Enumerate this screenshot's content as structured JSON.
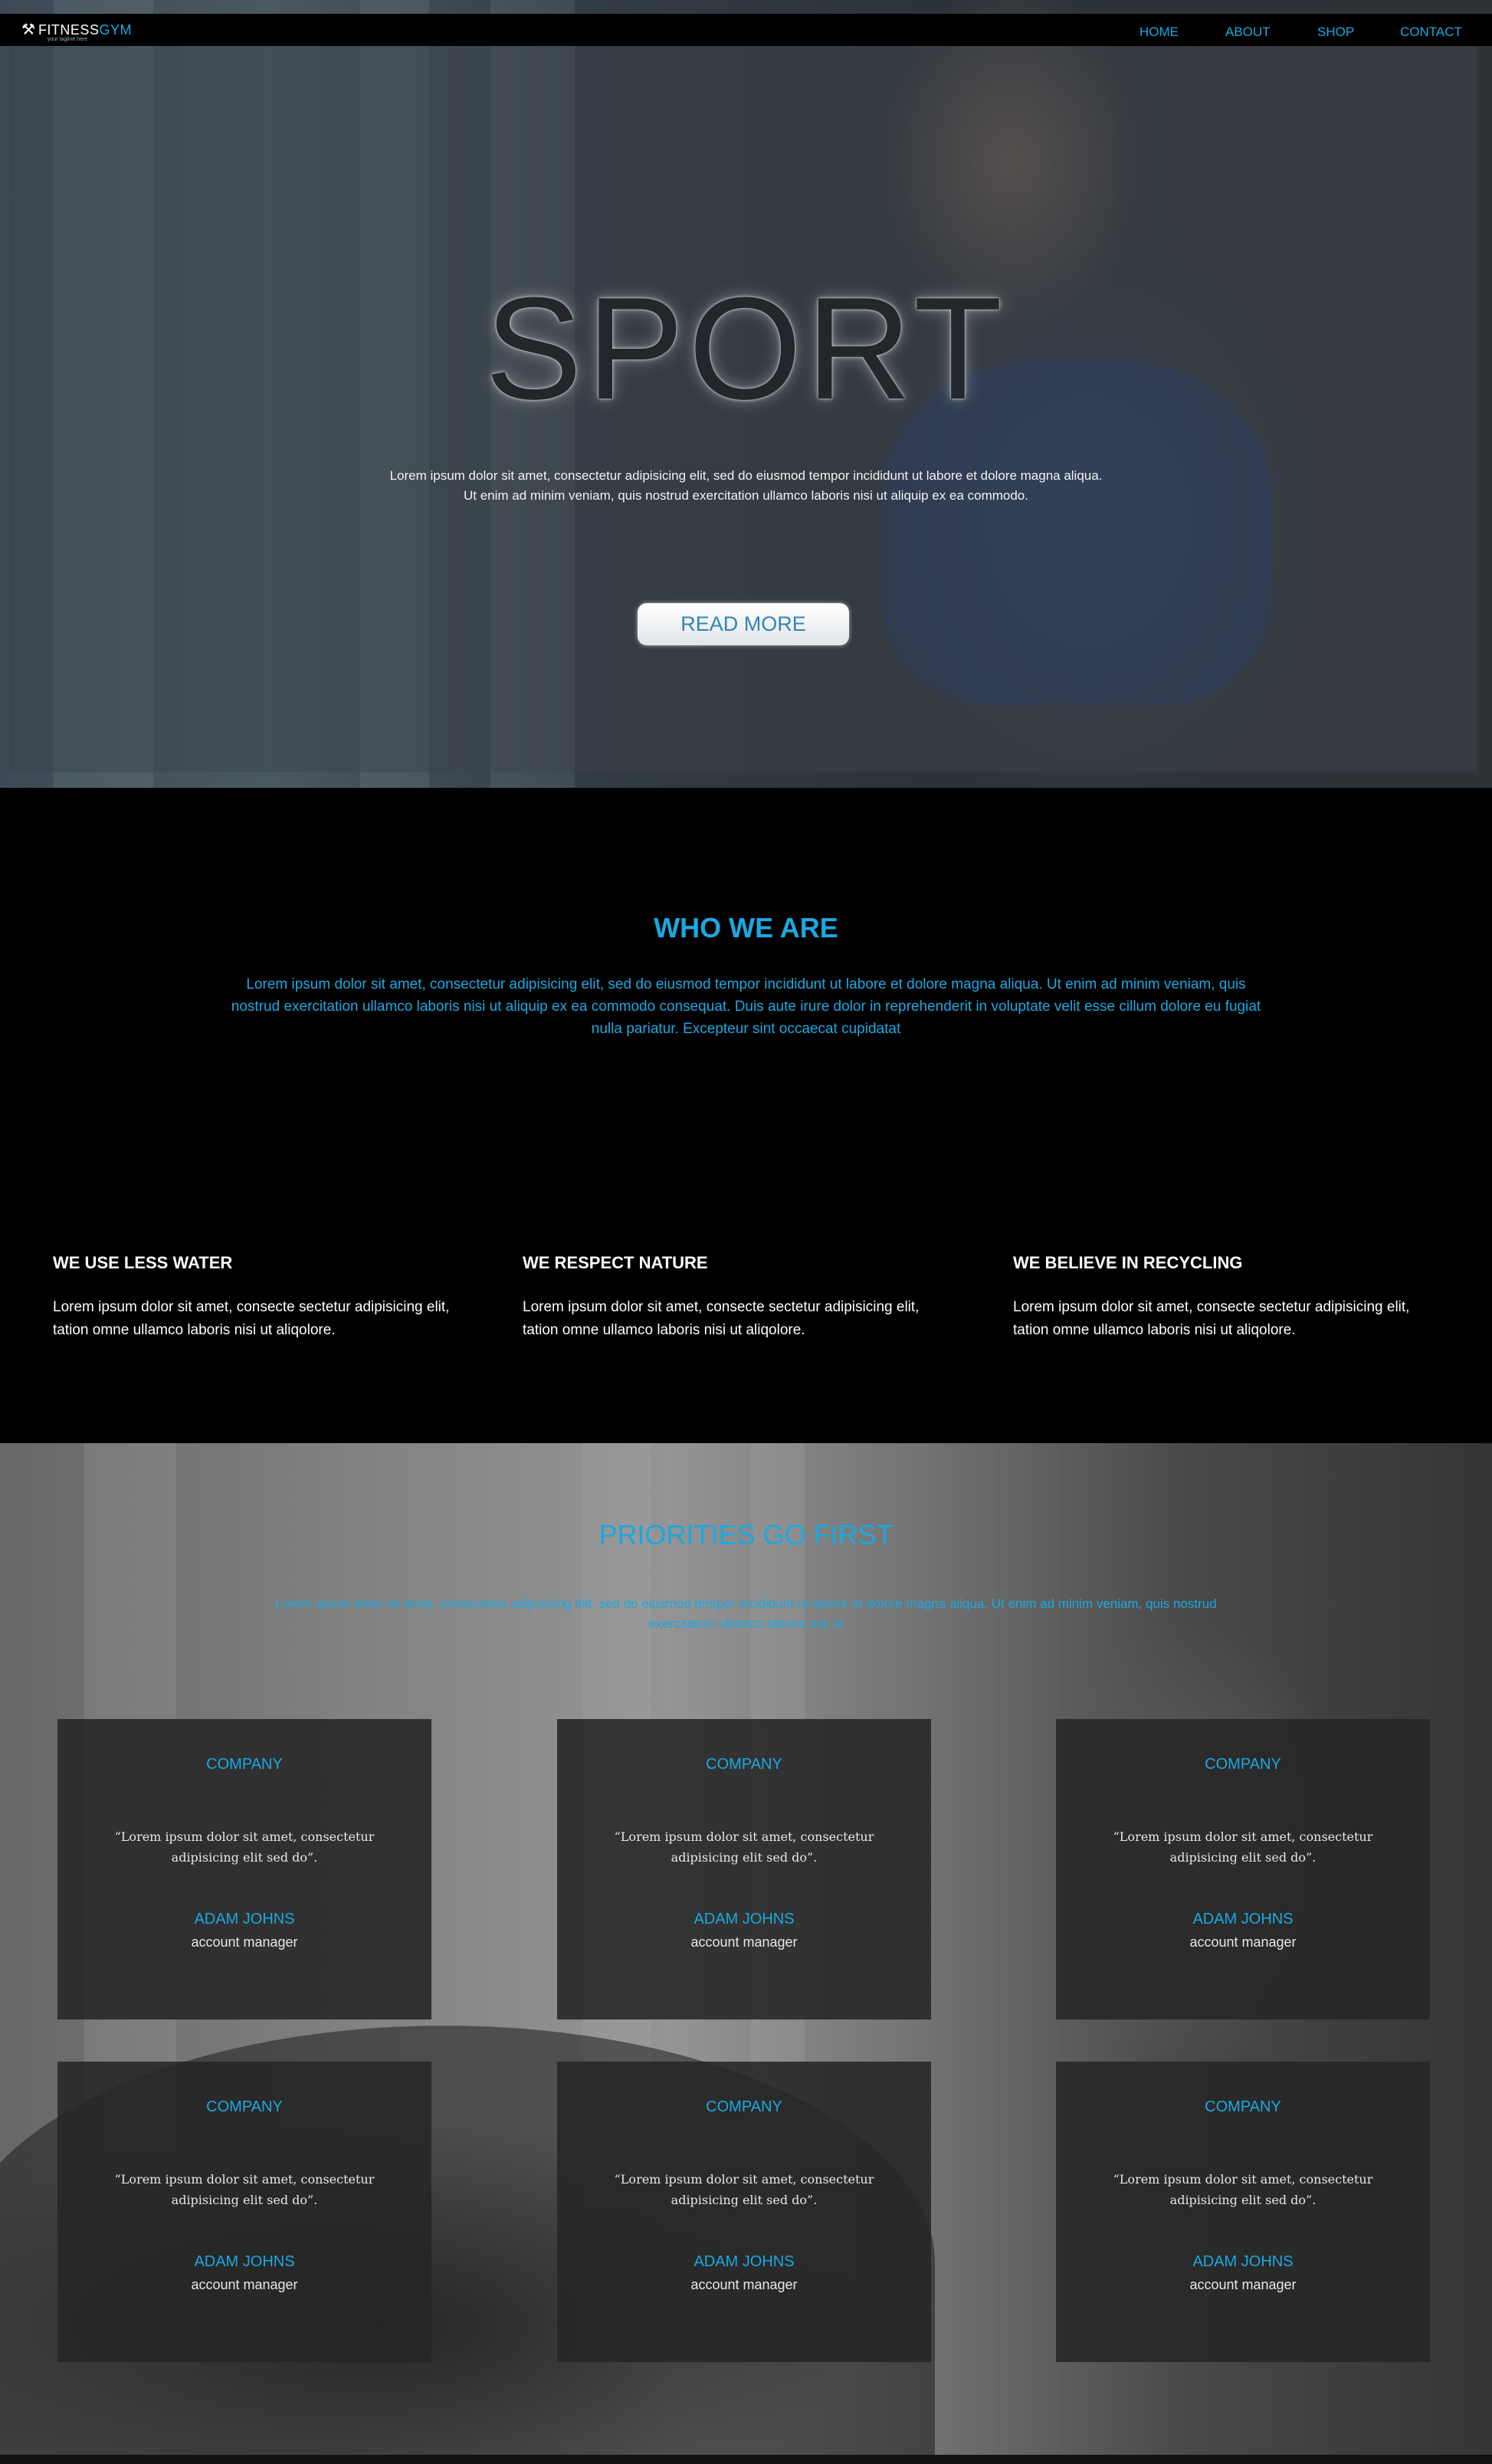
{
  "brand": {
    "name_part1": "FITNESS",
    "name_part2": "GYM",
    "tagline": "your tagline here",
    "accent_color": "#1aa9e1"
  },
  "nav": {
    "items": [
      "HOME",
      "ABOUT",
      "SHOP",
      "CONTACT"
    ]
  },
  "hero": {
    "title": "SPORT",
    "text": "Lorem ipsum dolor sit amet, consectetur adipisicing elit, sed do eiusmod tempor incididunt ut labore et dolore magna aliqua. Ut enim ad minim veniam, quis nostrud exercitation ullamco laboris nisi ut aliquip ex ea commodo.",
    "button_label": "READ MORE"
  },
  "who": {
    "title": "WHO WE ARE",
    "text": "Lorem ipsum dolor sit amet, consectetur adipisicing elit, sed do eiusmod tempor incididunt ut labore et dolore magna aliqua. Ut enim ad minim veniam, quis nostrud exercitation ullamco laboris nisi ut aliquip ex ea commodo consequat. Duis aute irure dolor in reprehenderit in voluptate velit esse cillum dolore eu fugiat nulla pariatur. Excepteur sint occaecat cupidatat"
  },
  "features": [
    {
      "title": "WE USE LESS WATER",
      "text": "Lorem ipsum dolor sit amet, consecte sectetur adipisicing elit, tation omne ullamco laboris nisi ut aliqolore."
    },
    {
      "title": "WE RESPECT NATURE",
      "text": "Lorem ipsum dolor sit amet, consecte sectetur adipisicing elit, tation omne ullamco laboris nisi ut aliqolore."
    },
    {
      "title": "WE BELIEVE IN RECYCLING",
      "text": "Lorem ipsum dolor sit amet, consecte sectetur adipisicing elit, tation omne ullamco laboris nisi ut aliqolore."
    }
  ],
  "priorities": {
    "title": "PRIORITIES GO FIRST",
    "text": "Lorem ipsum dolor sit amet, consectetur adipisicing elit, sed do eiusmod tempor incididunt ut labore et dolore magna aliqua. Ut enim ad minim veniam, quis nostrud exercitation ullamco laboris nisi ut"
  },
  "testimonials": [
    {
      "company": "COMPANY",
      "quote": "“Lorem ipsum dolor sit amet, consectetur adipisicing elit sed do”.",
      "name": "ADAM JOHNS",
      "role": "account manager"
    },
    {
      "company": "COMPANY",
      "quote": "“Lorem ipsum dolor sit amet, consectetur adipisicing elit sed do”.",
      "name": "ADAM JOHNS",
      "role": "account manager"
    },
    {
      "company": "COMPANY",
      "quote": "“Lorem ipsum dolor sit amet, consectetur adipisicing elit sed do”.",
      "name": "ADAM JOHNS",
      "role": "account manager"
    },
    {
      "company": "COMPANY",
      "quote": "“Lorem ipsum dolor sit amet, consectetur adipisicing elit sed do”.",
      "name": "ADAM JOHNS",
      "role": "account manager"
    },
    {
      "company": "COMPANY",
      "quote": "“Lorem ipsum dolor sit amet, consectetur adipisicing elit sed do”.",
      "name": "ADAM JOHNS",
      "role": "account manager"
    },
    {
      "company": "COMPANY",
      "quote": "“Lorem ipsum dolor sit amet, consectetur adipisicing elit sed do”.",
      "name": "ADAM JOHNS",
      "role": "account manager"
    }
  ]
}
